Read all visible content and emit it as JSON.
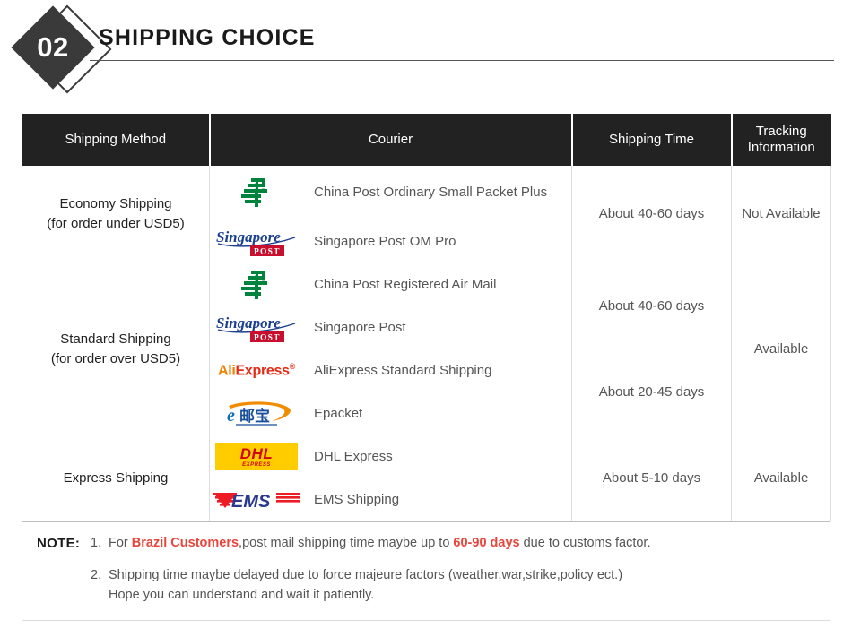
{
  "section": {
    "number": "02",
    "title": "SHIPPING CHOICE"
  },
  "table": {
    "headers": {
      "method": "Shipping Method",
      "courier": "Courier",
      "time": "Shipping Time",
      "tracking_line1": "Tracking",
      "tracking_line2": "Information"
    },
    "groups": [
      {
        "method_line1": "Economy Shipping",
        "method_line2": "(for order under USD5)",
        "couriers": [
          {
            "logo": "china-post-logo",
            "name": "China Post Ordinary Small Packet Plus"
          },
          {
            "logo": "singapore-post-logo",
            "name": "Singapore Post OM Pro"
          }
        ],
        "times": [
          {
            "label": "About 40-60 days",
            "rows": 2
          }
        ],
        "tracking": "Not Available"
      },
      {
        "method_line1": "Standard Shipping",
        "method_line2": "(for order over USD5)",
        "couriers": [
          {
            "logo": "china-post-logo",
            "name": "China Post Registered Air Mail"
          },
          {
            "logo": "singapore-post-logo",
            "name": "Singapore Post"
          },
          {
            "logo": "aliexpress-logo",
            "name": "AliExpress Standard Shipping"
          },
          {
            "logo": "epacket-logo",
            "name": "Epacket"
          }
        ],
        "times": [
          {
            "label": "About 40-60 days",
            "rows": 2
          },
          {
            "label": "About 20-45 days",
            "rows": 2
          }
        ],
        "tracking": "Available"
      },
      {
        "method_line1": "Express Shipping",
        "method_line2": "",
        "couriers": [
          {
            "logo": "dhl-logo",
            "name": "DHL Express"
          },
          {
            "logo": "ems-logo",
            "name": "EMS Shipping"
          }
        ],
        "times": [
          {
            "label": "About 5-10 days",
            "rows": 2
          }
        ],
        "tracking": "Available"
      }
    ]
  },
  "note": {
    "label": "NOTE:",
    "item1_num": "1.",
    "item1_a": "For ",
    "item1_highlight1": "Brazil Customers",
    "item1_b": ",post mail shipping time maybe up to ",
    "item1_highlight2": "60-90 days",
    "item1_c": " due to customs factor.",
    "item2_num": "2.",
    "item2_line1": "Shipping time maybe delayed due to force majeure factors (weather,war,strike,policy ect.)",
    "item2_line2": "Hope you can understand and wait it patiently."
  },
  "colors": {
    "header_bg": "#222222",
    "badge": "#3a3a3a",
    "red_accent": "#e8453c",
    "china_post_green": "#00843d",
    "sgpost_blue": "#1a3f8f",
    "sgpost_red": "#c8102e",
    "aliexpress_orange": "#f08200",
    "aliexpress_red": "#e32b16",
    "dhl_yellow": "#ffcc00",
    "dhl_red": "#d40511",
    "ems_blue": "#2b3990",
    "ems_red": "#ed1c24",
    "epacket_orange": "#f08c00"
  }
}
